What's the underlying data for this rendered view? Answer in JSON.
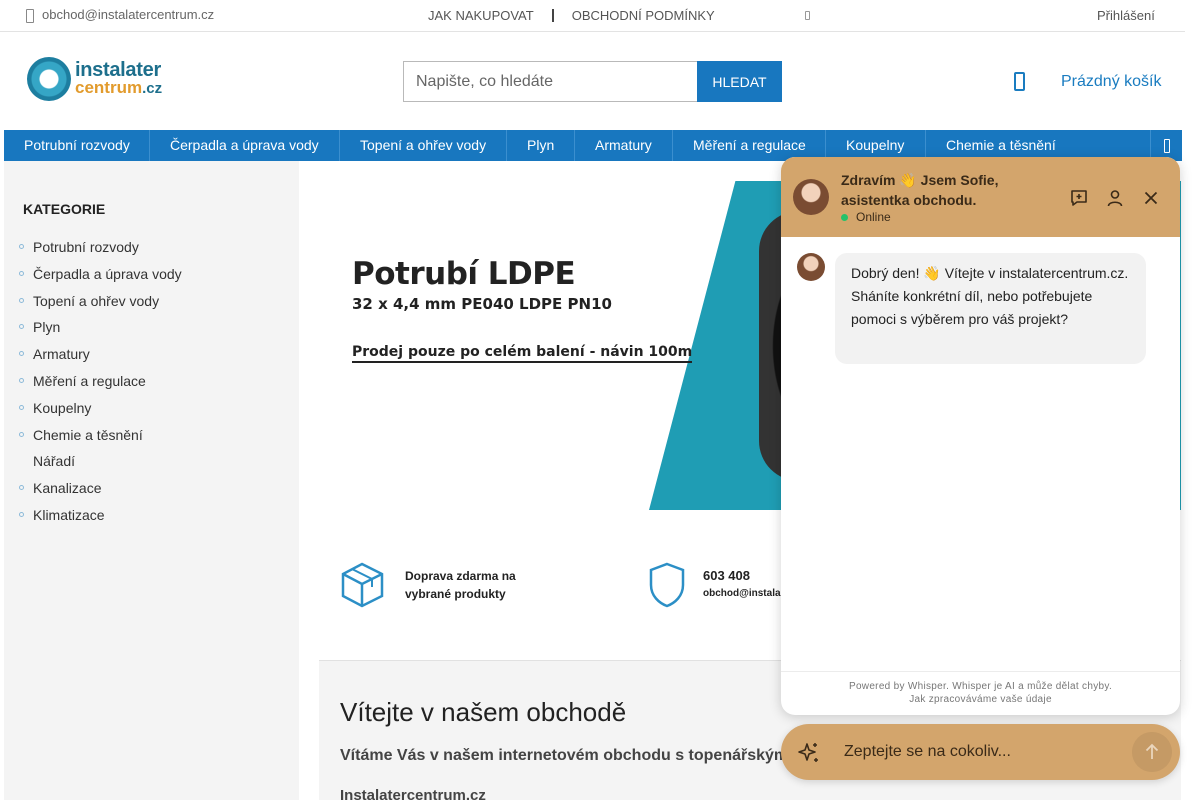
{
  "topbar": {
    "email": "obchod@instalatercentrum.cz",
    "links": [
      "JAK NAKUPOVAT",
      "OBCHODNÍ PODMÍNKY"
    ],
    "login": "Přihlášení"
  },
  "header": {
    "logo_line1": "instalater",
    "logo_line2": "centrum",
    "logo_tld": ".cz",
    "search_placeholder": "Napište, co hledáte",
    "search_button": "HLEDAT",
    "cart_label": "Prázdný košík"
  },
  "nav": {
    "items": [
      "Potrubní rozvody",
      "Čerpadla a úprava vody",
      "Topení a ohřev vody",
      "Plyn",
      "Armatury",
      "Měření a regulace",
      "Koupelny",
      "Chemie a těsnění"
    ]
  },
  "sidebar": {
    "heading": "KATEGORIE",
    "items": [
      "Potrubní rozvody",
      "Čerpadla a úprava vody",
      "Topení a ohřev vody",
      "Plyn",
      "Armatury",
      "Měření a regulace",
      "Koupelny",
      "Chemie a těsnění",
      "Nářadí",
      "Kanalizace",
      "Klimatizace"
    ]
  },
  "banner": {
    "title": "Potrubí LDPE",
    "subtitle": "32 x 4,4 mm PE040 LDPE PN10",
    "note": "Prodej pouze po celém balení - návin 100m"
  },
  "features": {
    "shipping_line1": "Doprava zdarma na",
    "shipping_line2": "vybrané produkty",
    "phone": "603 408",
    "email": "obchod@instala"
  },
  "welcome": {
    "title": "Vítejte v našem obchodě",
    "subtitle": "Vítáme Vás v našem internetovém obchodu s topenářským",
    "subtitle2": "Instalatercentrum.cz"
  },
  "chat": {
    "title": "Zdravím 👋 Jsem Sofie, asistentka obchodu.",
    "status": "Online",
    "message": "Dobrý den! 👋 Vítejte v instalatercentrum.cz. Sháníte konkrétní díl, nebo potřebujete pomoci s výběrem pro váš projekt?",
    "footer_line1": "Powered by Whisper. Whisper je AI a může dělat chyby.",
    "footer_line2": "Jak zpracováváme vaše údaje",
    "input_placeholder": "Zeptejte se na cokoliv...",
    "accent_color": "#d3a56c"
  },
  "colors": {
    "brand_blue": "#1877bf",
    "banner_teal": "#1f9db4"
  }
}
